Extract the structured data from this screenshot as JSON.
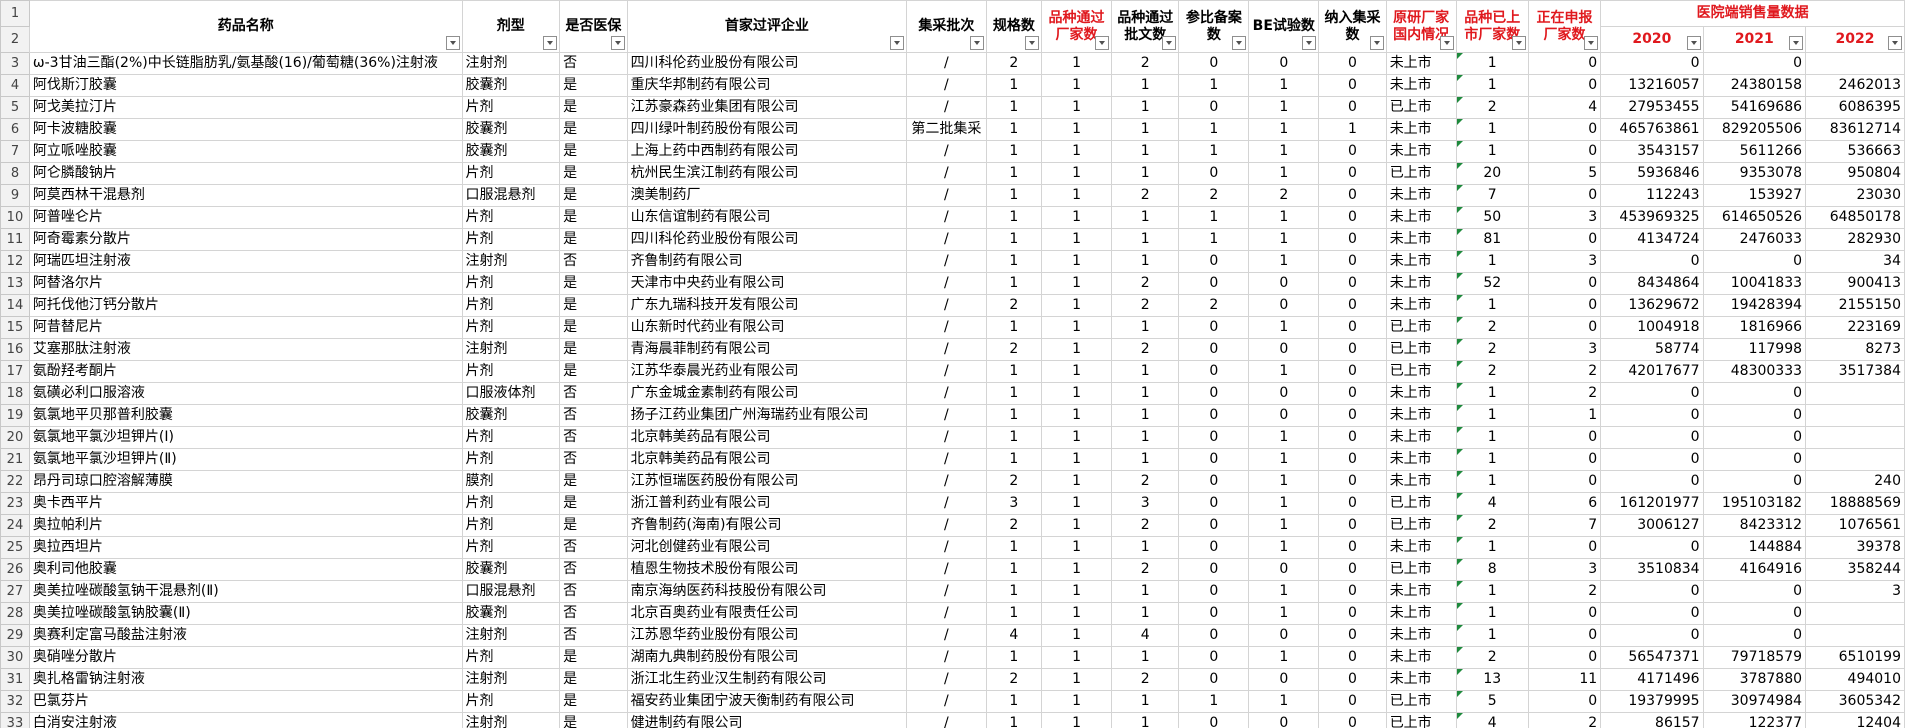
{
  "header": {
    "drug_name": "药品名称",
    "dosage_form": "剂型",
    "medical_insurance": "是否医保",
    "first_company": "首家过评企业",
    "batch": "集采批次",
    "spec_count": "规格数",
    "passed_makers": "品种通过厂家数",
    "passed_docs": "品种通过批文数",
    "reference_filing": "参比备案数",
    "be_trials": "BE试验数",
    "in_procurement": "纳入集采数",
    "originator_status": "原研厂家国内情况",
    "listed_makers": "品种已上市厂家数",
    "applying_makers": "正在申报厂家数",
    "sales_group": "医院端销售量数据",
    "y2020": "2020",
    "y2021": "2021",
    "y2022": "2022"
  },
  "row_numbers": [
    "1",
    "2",
    "3",
    "4",
    "5",
    "6",
    "7",
    "8",
    "9",
    "10",
    "11",
    "12",
    "13",
    "14",
    "15",
    "16",
    "17",
    "18",
    "19",
    "20",
    "21",
    "22",
    "23",
    "24",
    "25",
    "26",
    "27",
    "28",
    "29",
    "30",
    "31",
    "32",
    "33"
  ],
  "rows": [
    [
      "ω-3甘油三酯(2%)中长链脂肪乳/氨基酸(16)/葡萄糖(36%)注射液",
      "注射剂",
      "否",
      "四川科伦药业股份有限公司",
      "/",
      "2",
      "1",
      "2",
      "0",
      "0",
      "0",
      "未上市",
      "1",
      "0",
      "0",
      "0",
      ""
    ],
    [
      "阿伐斯汀胶囊",
      "胶囊剂",
      "是",
      "重庆华邦制药有限公司",
      "/",
      "1",
      "1",
      "1",
      "1",
      "1",
      "0",
      "未上市",
      "1",
      "0",
      "13216057",
      "24380158",
      "2462013"
    ],
    [
      "阿戈美拉汀片",
      "片剂",
      "是",
      "江苏豪森药业集团有限公司",
      "/",
      "1",
      "1",
      "1",
      "0",
      "1",
      "0",
      "已上市",
      "2",
      "4",
      "27953455",
      "54169686",
      "6086395"
    ],
    [
      "阿卡波糖胶囊",
      "胶囊剂",
      "是",
      "四川绿叶制药股份有限公司",
      "第二批集采",
      "1",
      "1",
      "1",
      "1",
      "1",
      "1",
      "未上市",
      "1",
      "0",
      "465763861",
      "829205506",
      "83612714"
    ],
    [
      "阿立哌唑胶囊",
      "胶囊剂",
      "是",
      "上海上药中西制药有限公司",
      "/",
      "1",
      "1",
      "1",
      "1",
      "1",
      "0",
      "未上市",
      "1",
      "0",
      "3543157",
      "5611266",
      "536663"
    ],
    [
      "阿仑膦酸钠片",
      "片剂",
      "是",
      "杭州民生滨江制药有限公司",
      "/",
      "1",
      "1",
      "1",
      "0",
      "1",
      "0",
      "已上市",
      "20",
      "5",
      "5936846",
      "9353078",
      "950804"
    ],
    [
      "阿莫西林干混悬剂",
      "口服混悬剂",
      "是",
      "澳美制药厂",
      "/",
      "1",
      "1",
      "2",
      "2",
      "2",
      "0",
      "未上市",
      "7",
      "0",
      "112243",
      "153927",
      "23030"
    ],
    [
      "阿普唑仑片",
      "片剂",
      "是",
      "山东信谊制药有限公司",
      "/",
      "1",
      "1",
      "1",
      "1",
      "1",
      "0",
      "未上市",
      "50",
      "3",
      "453969325",
      "614650526",
      "64850178"
    ],
    [
      "阿奇霉素分散片",
      "片剂",
      "是",
      "四川科伦药业股份有限公司",
      "/",
      "1",
      "1",
      "1",
      "1",
      "1",
      "0",
      "未上市",
      "81",
      "0",
      "4134724",
      "2476033",
      "282930"
    ],
    [
      "阿瑞匹坦注射液",
      "注射剂",
      "否",
      "齐鲁制药有限公司",
      "/",
      "1",
      "1",
      "1",
      "0",
      "1",
      "0",
      "未上市",
      "1",
      "3",
      "0",
      "0",
      "34"
    ],
    [
      "阿替洛尔片",
      "片剂",
      "是",
      "天津市中央药业有限公司",
      "/",
      "1",
      "1",
      "2",
      "0",
      "0",
      "0",
      "未上市",
      "52",
      "0",
      "8434864",
      "10041833",
      "900413"
    ],
    [
      "阿托伐他汀钙分散片",
      "片剂",
      "是",
      "广东九瑞科技开发有限公司",
      "/",
      "2",
      "1",
      "2",
      "2",
      "0",
      "0",
      "未上市",
      "1",
      "0",
      "13629672",
      "19428394",
      "2155150"
    ],
    [
      "阿昔替尼片",
      "片剂",
      "是",
      "山东新时代药业有限公司",
      "/",
      "1",
      "1",
      "1",
      "0",
      "1",
      "0",
      "已上市",
      "2",
      "0",
      "1004918",
      "1816966",
      "223169"
    ],
    [
      "艾塞那肽注射液",
      "注射剂",
      "是",
      "青海晨菲制药有限公司",
      "/",
      "2",
      "1",
      "2",
      "0",
      "0",
      "0",
      "已上市",
      "2",
      "3",
      "58774",
      "117998",
      "8273"
    ],
    [
      "氨酚羟考酮片",
      "片剂",
      "是",
      "江苏华泰晨光药业有限公司",
      "/",
      "1",
      "1",
      "1",
      "0",
      "1",
      "0",
      "已上市",
      "2",
      "2",
      "42017677",
      "48300333",
      "3517384"
    ],
    [
      "氨磺必利口服溶液",
      "口服液体剂",
      "否",
      "广东金城金素制药有限公司",
      "/",
      "1",
      "1",
      "1",
      "0",
      "0",
      "0",
      "未上市",
      "1",
      "2",
      "0",
      "0",
      ""
    ],
    [
      "氨氯地平贝那普利胶囊",
      "胶囊剂",
      "否",
      "扬子江药业集团广州海瑞药业有限公司",
      "/",
      "1",
      "1",
      "1",
      "0",
      "0",
      "0",
      "未上市",
      "1",
      "1",
      "0",
      "0",
      ""
    ],
    [
      "氨氯地平氯沙坦钾片(Ⅰ)",
      "片剂",
      "否",
      "北京韩美药品有限公司",
      "/",
      "1",
      "1",
      "1",
      "0",
      "1",
      "0",
      "未上市",
      "1",
      "0",
      "0",
      "0",
      ""
    ],
    [
      "氨氯地平氯沙坦钾片(Ⅱ)",
      "片剂",
      "否",
      "北京韩美药品有限公司",
      "/",
      "1",
      "1",
      "1",
      "0",
      "1",
      "0",
      "未上市",
      "1",
      "0",
      "0",
      "0",
      ""
    ],
    [
      "昂丹司琼口腔溶解薄膜",
      "膜剂",
      "是",
      "江苏恒瑞医药股份有限公司",
      "/",
      "2",
      "1",
      "2",
      "0",
      "1",
      "0",
      "未上市",
      "1",
      "0",
      "0",
      "0",
      "240"
    ],
    [
      "奥卡西平片",
      "片剂",
      "是",
      "浙江普利药业有限公司",
      "/",
      "3",
      "1",
      "3",
      "0",
      "1",
      "0",
      "已上市",
      "4",
      "6",
      "161201977",
      "195103182",
      "18888569"
    ],
    [
      "奥拉帕利片",
      "片剂",
      "是",
      "齐鲁制药(海南)有限公司",
      "/",
      "2",
      "1",
      "2",
      "0",
      "1",
      "0",
      "已上市",
      "2",
      "7",
      "3006127",
      "8423312",
      "1076561"
    ],
    [
      "奥拉西坦片",
      "片剂",
      "否",
      "河北创健药业有限公司",
      "/",
      "1",
      "1",
      "1",
      "0",
      "1",
      "0",
      "未上市",
      "1",
      "0",
      "0",
      "144884",
      "39378"
    ],
    [
      "奥利司他胶囊",
      "胶囊剂",
      "否",
      "植恩生物技术股份有限公司",
      "/",
      "1",
      "1",
      "2",
      "0",
      "0",
      "0",
      "已上市",
      "8",
      "3",
      "3510834",
      "4164916",
      "358244"
    ],
    [
      "奥美拉唑碳酸氢钠干混悬剂(Ⅱ)",
      "口服混悬剂",
      "否",
      "南京海纳医药科技股份有限公司",
      "/",
      "1",
      "1",
      "1",
      "0",
      "1",
      "0",
      "未上市",
      "1",
      "2",
      "0",
      "0",
      "3"
    ],
    [
      "奥美拉唑碳酸氢钠胶囊(Ⅱ)",
      "胶囊剂",
      "否",
      "北京百奥药业有限责任公司",
      "/",
      "1",
      "1",
      "1",
      "0",
      "1",
      "0",
      "未上市",
      "1",
      "0",
      "0",
      "0",
      ""
    ],
    [
      "奥赛利定富马酸盐注射液",
      "注射剂",
      "否",
      "江苏恩华药业股份有限公司",
      "/",
      "4",
      "1",
      "4",
      "0",
      "0",
      "0",
      "未上市",
      "1",
      "0",
      "0",
      "0",
      ""
    ],
    [
      "奥硝唑分散片",
      "片剂",
      "是",
      "湖南九典制药股份有限公司",
      "/",
      "1",
      "1",
      "1",
      "0",
      "1",
      "0",
      "未上市",
      "2",
      "0",
      "56547371",
      "79718579",
      "6510199"
    ],
    [
      "奥扎格雷钠注射液",
      "注射剂",
      "是",
      "浙江北生药业汉生制药有限公司",
      "/",
      "2",
      "1",
      "2",
      "0",
      "0",
      "0",
      "未上市",
      "13",
      "11",
      "4171496",
      "3787880",
      "494010"
    ],
    [
      "巴氯芬片",
      "片剂",
      "是",
      "福安药业集团宁波天衡制药有限公司",
      "/",
      "1",
      "1",
      "1",
      "1",
      "1",
      "0",
      "已上市",
      "5",
      "0",
      "19379995",
      "30974984",
      "3605342"
    ],
    [
      "白消安注射液",
      "注射剂",
      "是",
      "健进制药有限公司",
      "/",
      "1",
      "1",
      "1",
      "0",
      "0",
      "0",
      "已上市",
      "4",
      "2",
      "86157",
      "122377",
      "12404"
    ]
  ]
}
